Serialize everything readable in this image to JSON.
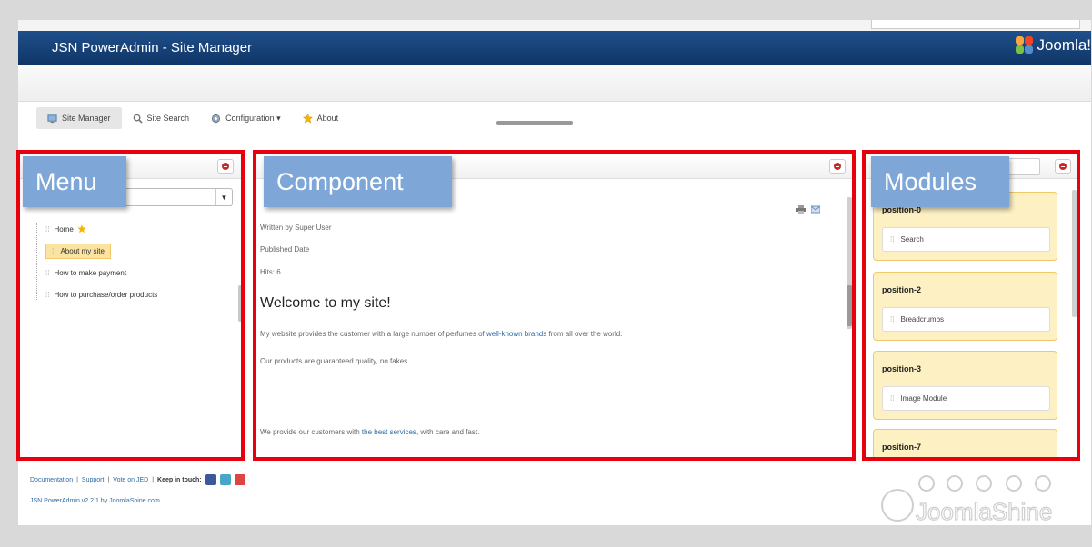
{
  "app": {
    "title": "JSN PowerAdmin - Site Manager",
    "logo_text": "Joomla!"
  },
  "toolbar": {
    "items": [
      {
        "label": "Site Manager",
        "icon": "site-manager-icon",
        "active": true
      },
      {
        "label": "Site Search",
        "icon": "search-icon"
      },
      {
        "label": "Configuration ▾",
        "icon": "gear-icon"
      },
      {
        "label": "About",
        "icon": "star-icon"
      }
    ]
  },
  "overlays": {
    "menu": "Menu",
    "component": "Component",
    "modules": "Modules"
  },
  "menu": {
    "items": [
      {
        "label": "Home",
        "home": true
      },
      {
        "label": "About my site",
        "selected": true
      },
      {
        "label": "How to make payment"
      },
      {
        "label": "How to purchase/order products"
      }
    ]
  },
  "article": {
    "author": "Written by Super User",
    "published": "Published Date",
    "hits": "Hits: 6",
    "heading": "Welcome to my site!",
    "p1_before": "My website provides the customer with a large number of perfumes of ",
    "p1_link": "well-known brands",
    "p1_after": " from all over the world.",
    "p2": "Our products are guaranteed quality, no fakes.",
    "p3_before": "We provide our customers with ",
    "p3_link": "the best services",
    "p3_after": ", with care and fast."
  },
  "modules": {
    "positions": [
      {
        "name": "position-0",
        "module": "Search"
      },
      {
        "name": "position-2",
        "module": "Breadcrumbs"
      },
      {
        "name": "position-3",
        "module": "Image Module"
      },
      {
        "name": "position-7",
        "module": ""
      }
    ]
  },
  "footer": {
    "link_documentation": "Documentation",
    "link_support": "Support",
    "link_vote": "Vote on JED",
    "keep_in_touch": "Keep in touch:",
    "separator": "|",
    "credit": "JSN PowerAdmin v2.2.1 by JoomlaShine.com"
  },
  "brand": {
    "name": "JoomlaShine"
  },
  "colors": {
    "highlight_border": "#e8000d",
    "overlay_label": "#7ea7d8",
    "titlebar": "#1a4478",
    "module_bg": "#fdf1c4"
  }
}
